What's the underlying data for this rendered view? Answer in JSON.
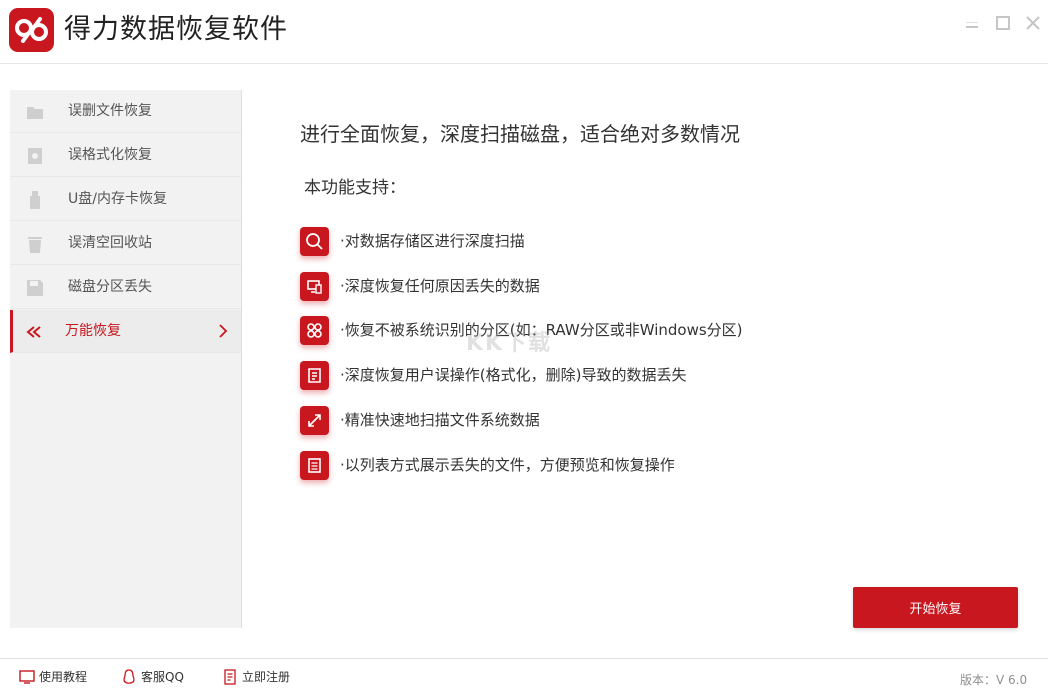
{
  "app": {
    "title": "得力数据恢复软件",
    "accent_color": "#c8171f",
    "logo_icon": "infinity-logo-icon"
  },
  "window_controls": {
    "minimize": "minimize-icon",
    "maximize": "maximize-icon",
    "close": "close-icon"
  },
  "sidebar": {
    "items": [
      {
        "label": "误删文件恢复",
        "icon": "folder-icon",
        "active": false
      },
      {
        "label": "误格式化恢复",
        "icon": "format-icon",
        "active": false
      },
      {
        "label": "U盘/内存卡恢复",
        "icon": "usb-drive-icon",
        "active": false
      },
      {
        "label": "误清空回收站",
        "icon": "trash-icon",
        "active": false
      },
      {
        "label": "磁盘分区丢失",
        "icon": "disk-icon",
        "active": false
      },
      {
        "label": "万能恢复",
        "icon": "double-arrow-back-icon",
        "active": true
      }
    ]
  },
  "main": {
    "headline": "进行全面恢复，深度扫描磁盘，适合绝对多数情况",
    "support_title": "本功能支持：",
    "features": [
      {
        "text": "·对数据存储区进行深度扫描",
        "icon": "magnifier-icon"
      },
      {
        "text": "·深度恢复任何原因丢失的数据",
        "icon": "devices-icon"
      },
      {
        "text": "·恢复不被系统识别的分区(如：RAW分区或非Windows分区)",
        "icon": "partition-grid-icon"
      },
      {
        "text": "·深度恢复用户误操作(格式化，删除)导致的数据丢失",
        "icon": "document-restore-icon"
      },
      {
        "text": "·精准快速地扫描文件系统数据",
        "icon": "resize-arrows-icon"
      },
      {
        "text": "·以列表方式展示丢失的文件，方便预览和恢复操作",
        "icon": "list-document-icon"
      }
    ],
    "watermark": "KK下载",
    "start_button": "开始恢复"
  },
  "footer": {
    "tutorial": "使用教程",
    "support_qq": "客服QQ",
    "register": "立即注册",
    "version": "版本：V 6.0"
  }
}
